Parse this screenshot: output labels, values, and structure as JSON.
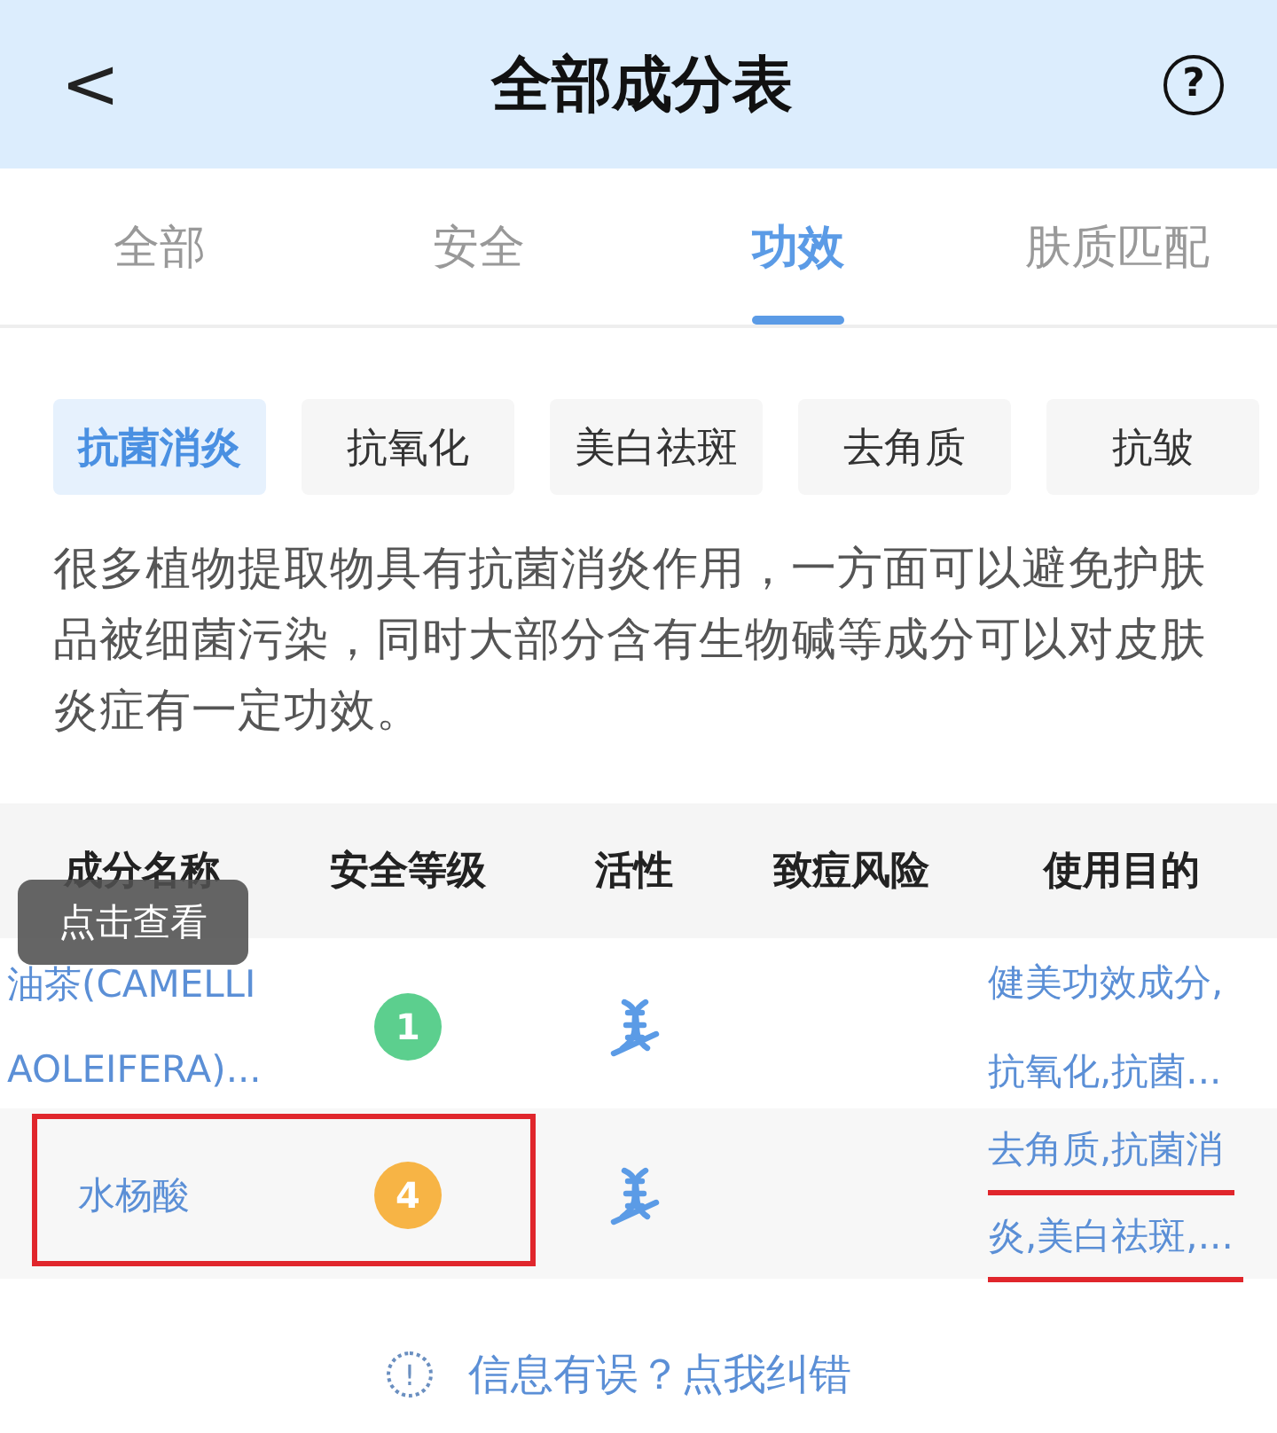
{
  "header": {
    "back": "<",
    "title": "全部成分表",
    "help": "?"
  },
  "tabs": [
    {
      "label": "全部",
      "selected": false
    },
    {
      "label": "安全",
      "selected": false
    },
    {
      "label": "功效",
      "selected": true
    },
    {
      "label": "肤质匹配",
      "selected": false
    }
  ],
  "chips": [
    {
      "label": "抗菌消炎",
      "selected": true
    },
    {
      "label": "抗氧化",
      "selected": false
    },
    {
      "label": "美白祛斑",
      "selected": false
    },
    {
      "label": "去角质",
      "selected": false
    },
    {
      "label": "抗皱",
      "selected": false
    }
  ],
  "description": "很多植物提取物具有抗菌消炎作用，一方面可以避免护肤品被细菌污染，同时大部分含有生物碱等成分可以对皮肤炎症有一定功效。",
  "table": {
    "columns": [
      "成分名称",
      "安全等级",
      "活性",
      "致痘风险",
      "使用目的"
    ],
    "tooltip": "点击查看",
    "rows": [
      {
        "name_lines": [
          "油茶(CAMELLI",
          "AOLEIFERA)..."
        ],
        "level": "1",
        "color": "#5ccf8e",
        "active": true,
        "purpose_lines": [
          "健美功效成分,",
          "抗氧化,抗菌..."
        ],
        "highlighted": false,
        "purpose_underlined": false
      },
      {
        "name_lines": [
          "水杨酸"
        ],
        "level": "4",
        "color": "#f7b445",
        "active": true,
        "purpose_lines": [
          "去角质,抗菌消",
          "炎,美白祛斑,..."
        ],
        "highlighted": true,
        "purpose_underlined": true
      }
    ]
  },
  "footer": {
    "icon": "!",
    "text": "信息有误？点我纠错"
  }
}
